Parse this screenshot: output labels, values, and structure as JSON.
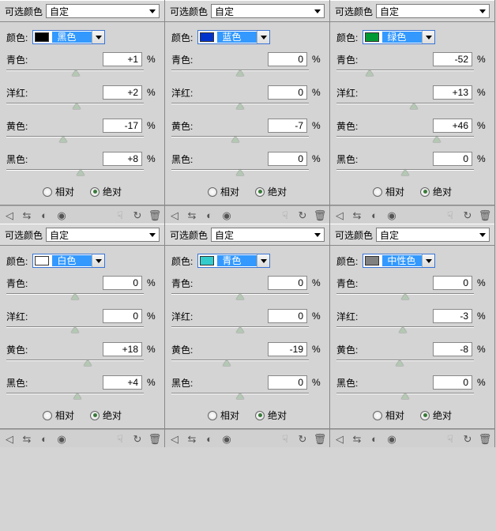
{
  "labels": {
    "selective_color": "可选颜色",
    "custom": "自定",
    "color": "颜色:",
    "cyan": "青色:",
    "magenta": "洋红:",
    "yellow": "黄色:",
    "black": "黑色:",
    "pct": "%",
    "relative": "相对",
    "absolute": "绝对"
  },
  "panels": [
    {
      "color_name": "黑色",
      "color_swatch": "#000000",
      "cmyk": {
        "c": "+1",
        "m": "+2",
        "y": "-17",
        "k": "+8"
      },
      "mode": "absolute",
      "show_iconbar": false
    },
    {
      "color_name": "蓝色",
      "color_swatch": "#0033cc",
      "cmyk": {
        "c": "0",
        "m": "0",
        "y": "-7",
        "k": "0"
      },
      "mode": "absolute",
      "show_iconbar": false
    },
    {
      "color_name": "绿色",
      "color_swatch": "#009933",
      "cmyk": {
        "c": "-52",
        "m": "+13",
        "y": "+46",
        "k": "0"
      },
      "mode": "absolute",
      "show_iconbar": false
    },
    {
      "color_name": "白色",
      "color_swatch": "#ffffff",
      "cmyk": {
        "c": "0",
        "m": "0",
        "y": "+18",
        "k": "+4"
      },
      "mode": "absolute",
      "show_iconbar": true
    },
    {
      "color_name": "青色",
      "color_swatch": "#33cccc",
      "cmyk": {
        "c": "0",
        "m": "0",
        "y": "-19",
        "k": "0"
      },
      "mode": "absolute",
      "show_iconbar": true
    },
    {
      "color_name": "中性色",
      "color_swatch": "#808080",
      "cmyk": {
        "c": "0",
        "m": "-3",
        "y": "-8",
        "k": "0"
      },
      "mode": "absolute",
      "show_iconbar": true
    }
  ]
}
